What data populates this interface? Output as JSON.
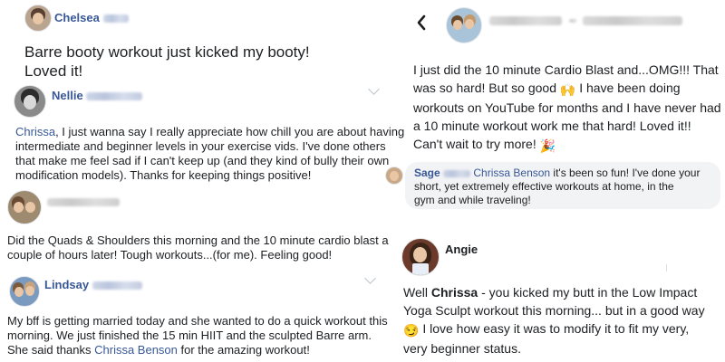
{
  "left": {
    "post1": {
      "author": "Chelsea",
      "body_line1": "Barre booty workout just kicked my booty!",
      "body_line2": "Loved it!"
    },
    "post2": {
      "author": "Nellie",
      "mention": "Chrissa",
      "line1_rest": ", I just wanna say I really appreciate how chill you are about having",
      "line2": "intermediate and beginner levels in your exercise vids. I've done others",
      "line3": "that make me feel sad if I can't keep up (and they kind of bully their own",
      "line4": "modification models). Thanks for keeping things positive!"
    },
    "post3": {
      "line1": "Did the Quads & Shoulders this morning and the 10 minute cardio blast a",
      "line2": "couple of hours later! Tough workouts...(for me). Feeling good!"
    },
    "post4": {
      "author": "Lindsay",
      "line1": "My bff is getting married today and she wanted to do a quick workout this",
      "line2": "morning. We just finished the 15 min HIIT and the sculpted Barre arm.",
      "line3_start": "She said thanks ",
      "mention": "Chrissa Benson",
      "line3_end": " for the amazing workout!"
    }
  },
  "right": {
    "message": {
      "back_icon": "chevron-left-icon",
      "line1": "I just did the 10 minute Cardio Blast and...OMG!!! That",
      "line2_start": "was so hard! But so good ",
      "line2_emoji": "🙌",
      "line2_end": " I have been doing",
      "line3": "workouts on YouTube for months and I have never had",
      "line4": "a 10 minute workout work me that hard! Loved it!!",
      "line5_start": "Can't wait to try more! ",
      "line5_emoji": "🎉"
    },
    "comment": {
      "author": "Sage",
      "mention": "Chrissa Benson",
      "line1_rest": " it's been so fun! I've done your",
      "line2": "short, yet extremely effective workouts at home, in the",
      "line3": "gym and while traveling!"
    },
    "post": {
      "author": "Angie",
      "line1_start": "Well ",
      "line1_bold": "Chrissa",
      "line1_end": " - you kicked my butt in the Low Impact",
      "line2": "Yoga Sculpt workout this morning... but in a good way",
      "line3_emoji": "😏",
      "line3_text": " I love how easy it was to modify it to fit my very,",
      "line4": "very beginner status."
    }
  },
  "colors": {
    "link": "#385898",
    "text": "#1c1e21",
    "comment_bg": "#f2f3f5"
  }
}
